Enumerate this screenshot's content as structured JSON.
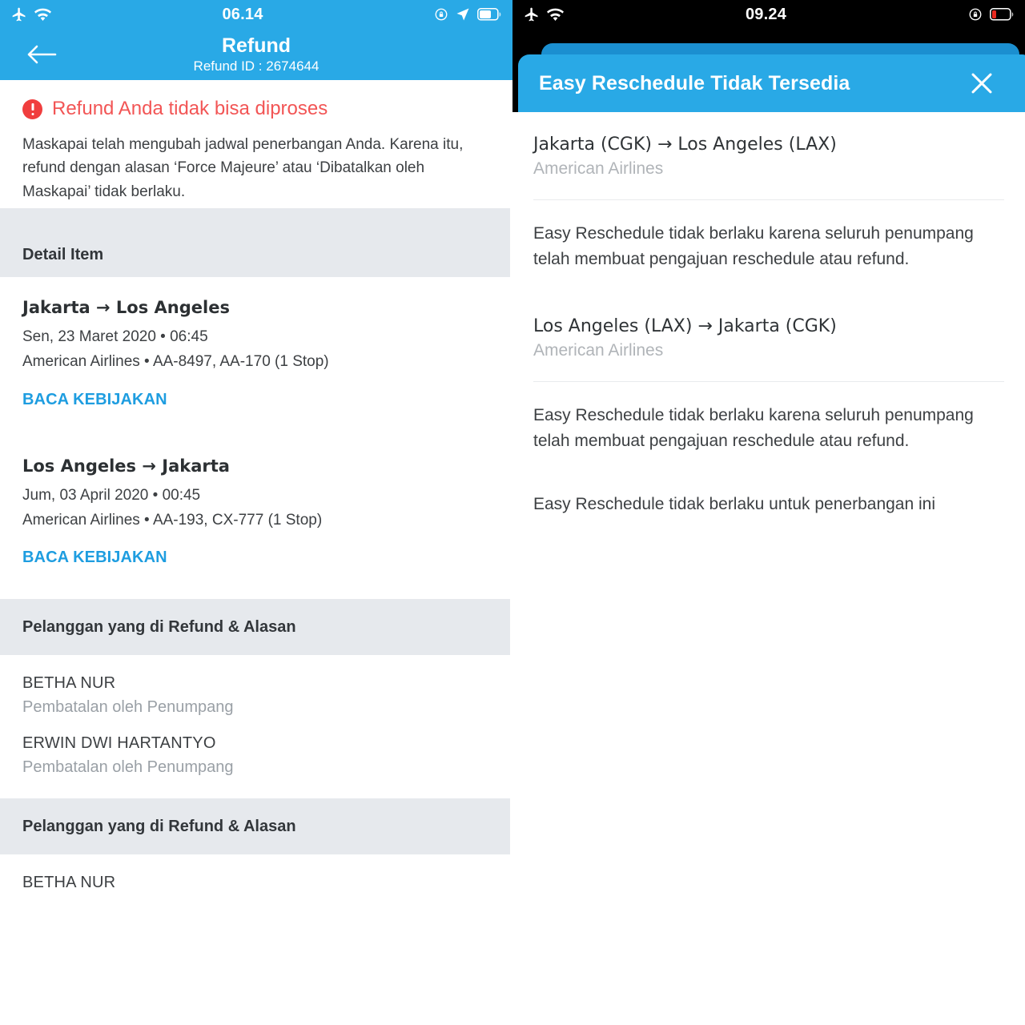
{
  "left_screen": {
    "status_bar": {
      "time": "06.14",
      "icons_left": [
        "airplane-mode-icon",
        "wifi-icon"
      ],
      "icons_right": [
        "rotation-lock-icon",
        "location-arrow-icon",
        "battery-icon"
      ],
      "background_color": "#29a9e6",
      "text_color": "#ffffff"
    },
    "navbar": {
      "back_icon": "back-arrow-icon",
      "title": "Refund",
      "subtitle": "Refund ID : 2674644",
      "background_color": "#29a9e6"
    },
    "error": {
      "icon": "error-exclamation-icon",
      "title": "Refund Anda tidak bisa diproses",
      "title_color": "#f25555",
      "body": "Maskapai telah mengubah jadwal penerbangan Anda. Karena itu, refund dengan alasan ‘Force Majeure’ atau ‘Dibatalkan oleh Maskapai’ tidak berlaku."
    },
    "detail_section": {
      "header": "Detail Item",
      "flights": [
        {
          "route": "Jakarta → Los Angeles",
          "datetime": "Sen, 23 Maret 2020 • 06:45",
          "airline_flights": "American Airlines • AA-8497, AA-170 (1 Stop)",
          "policy_link": "BACA KEBIJAKAN"
        },
        {
          "route": "Los Angeles → Jakarta",
          "datetime": "Jum, 03 April 2020 • 00:45",
          "airline_flights": "American Airlines • AA-193, CX-777 (1 Stop)",
          "policy_link": "BACA KEBIJAKAN"
        }
      ]
    },
    "passenger_section_1": {
      "header": "Pelanggan yang di Refund & Alasan",
      "passengers": [
        {
          "name": "BETHA NUR",
          "reason": "Pembatalan oleh Penumpang"
        },
        {
          "name": "ERWIN DWI HARTANTYO",
          "reason": "Pembatalan oleh Penumpang"
        }
      ]
    },
    "passenger_section_2": {
      "header": "Pelanggan yang di Refund & Alasan",
      "passengers": [
        {
          "name": "BETHA NUR"
        }
      ]
    }
  },
  "right_screen": {
    "status_bar": {
      "time": "09.24",
      "icons_left": [
        "airplane-mode-icon",
        "wifi-icon"
      ],
      "icons_right": [
        "rotation-lock-icon",
        "battery-low-icon"
      ],
      "background_color": "#000000",
      "text_color": "#ffffff",
      "battery_color": "#e8291f"
    },
    "sheet": {
      "title": "Easy Reschedule Tidak Tersedia",
      "close_icon": "close-icon",
      "header_color": "#29a9e6"
    },
    "groups": [
      {
        "route": "Jakarta (CGK) → Los Angeles (LAX)",
        "airline": "American Airlines",
        "note": "Easy Reschedule tidak berlaku karena seluruh penumpang telah membuat pengajuan reschedule atau refund."
      },
      {
        "route": "Los Angeles (LAX) → Jakarta (CGK)",
        "airline": "American Airlines",
        "note": "Easy Reschedule tidak berlaku karena seluruh penumpang telah membuat pengajuan reschedule atau refund."
      }
    ],
    "footer_note": "Easy Reschedule tidak berlaku untuk penerbangan ini"
  }
}
